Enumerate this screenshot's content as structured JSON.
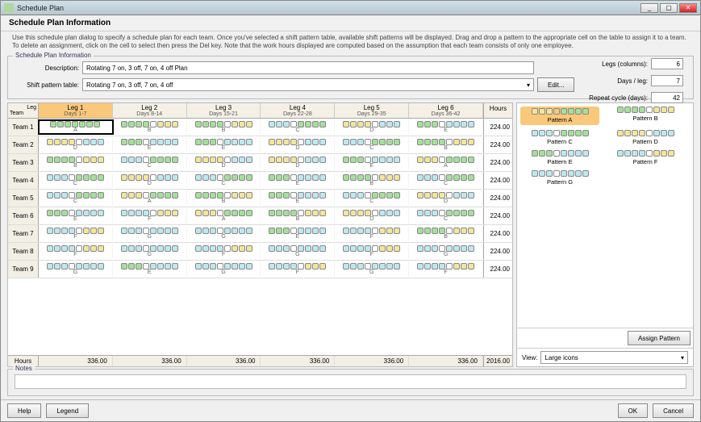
{
  "window_title": "Schedule Plan",
  "header_title": "Schedule Plan Information",
  "instructions": "Use this schedule plan dialog to specify a schedule plan for each team. Once you've selected a shift pattern table, available shift patterns will be displayed. Drag and drop a pattern to the appropriate cell on the table to assign it to a team. To delete an assignment, click on the cell to select then press the Del key. Note that the work hours displayed are computed based on the assumption that each team consists of only one employee.",
  "group_title": "Schedule Plan Information",
  "description_label": "Description:",
  "shift_table_label": "Shift pattern table:",
  "description_value": "Rotating 7 on, 3 off, 7 on, 4 off Plan",
  "shift_table_value": "Rotating 7 on, 3 off, 7 on, 4 off",
  "edit_button": "Edit...",
  "config": {
    "legs_label": "Legs (columns):",
    "legs_value": "6",
    "days_per_leg_label": "Days / leg:",
    "days_per_leg_value": "7",
    "repeat_label": "Repeat cycle (days):",
    "repeat_value": "42"
  },
  "grid": {
    "corner_top": "Leg",
    "corner_left": "Team",
    "hours_header": "Hours",
    "hours_footer_label": "Hours",
    "legs": [
      {
        "title": "Leg 1",
        "sub": "Days 1-7",
        "active": true
      },
      {
        "title": "Leg 2",
        "sub": "Days 8-14",
        "active": false
      },
      {
        "title": "Leg 3",
        "sub": "Days 15-21",
        "active": false
      },
      {
        "title": "Leg 4",
        "sub": "Days 22-28",
        "active": false
      },
      {
        "title": "Leg 5",
        "sub": "Days 29-35",
        "active": false
      },
      {
        "title": "Leg 6",
        "sub": "Days 36-42",
        "active": false
      }
    ],
    "teams": [
      {
        "name": "Team 1",
        "hours": "224.00",
        "cells": [
          {
            "label": "A",
            "pat": "sel"
          },
          {
            "label": "B",
            "pat": "gy"
          },
          {
            "label": "B",
            "pat": "gy"
          },
          {
            "label": "C",
            "pat": "bg"
          },
          {
            "label": "D",
            "pat": "yb"
          },
          {
            "label": "E",
            "pat": "gb"
          }
        ]
      },
      {
        "name": "Team 2",
        "hours": "224.00",
        "cells": [
          {
            "label": "D",
            "pat": "yb"
          },
          {
            "label": "E",
            "pat": "gb"
          },
          {
            "label": "E",
            "pat": "gb"
          },
          {
            "label": "D",
            "pat": "yb"
          },
          {
            "label": "C",
            "pat": "bg"
          },
          {
            "label": "B",
            "pat": "gy"
          }
        ]
      },
      {
        "name": "Team 3",
        "hours": "224.00",
        "cells": [
          {
            "label": "B",
            "pat": "gy"
          },
          {
            "label": "C",
            "pat": "bg"
          },
          {
            "label": "D",
            "pat": "yb"
          },
          {
            "label": "D",
            "pat": "yb"
          },
          {
            "label": "E",
            "pat": "gb"
          },
          {
            "label": "A",
            "pat": "yg"
          }
        ]
      },
      {
        "name": "Team 4",
        "hours": "224.00",
        "cells": [
          {
            "label": "C",
            "pat": "bg"
          },
          {
            "label": "D",
            "pat": "yb"
          },
          {
            "label": "C",
            "pat": "bg"
          },
          {
            "label": "E",
            "pat": "gb"
          },
          {
            "label": "B",
            "pat": "gy"
          },
          {
            "label": "C",
            "pat": "bg"
          }
        ]
      },
      {
        "name": "Team 5",
        "hours": "224.00",
        "cells": [
          {
            "label": "C",
            "pat": "bg"
          },
          {
            "label": "A",
            "pat": "yg"
          },
          {
            "label": "B",
            "pat": "gy"
          },
          {
            "label": "E",
            "pat": "gb"
          },
          {
            "label": "C",
            "pat": "bg"
          },
          {
            "label": "D",
            "pat": "yb"
          }
        ]
      },
      {
        "name": "Team 6",
        "hours": "224.00",
        "cells": [
          {
            "label": "E",
            "pat": "gb"
          },
          {
            "label": "F",
            "pat": "by"
          },
          {
            "label": "A",
            "pat": "yg"
          },
          {
            "label": "B",
            "pat": "gy"
          },
          {
            "label": "D",
            "pat": "yb"
          },
          {
            "label": "C",
            "pat": "bg"
          }
        ]
      },
      {
        "name": "Team 7",
        "hours": "224.00",
        "cells": [
          {
            "label": "F",
            "pat": "by"
          },
          {
            "label": "G",
            "pat": "bb"
          },
          {
            "label": "G",
            "pat": "bb"
          },
          {
            "label": "E",
            "pat": "gb"
          },
          {
            "label": "F",
            "pat": "by"
          },
          {
            "label": "B",
            "pat": "gy"
          }
        ]
      },
      {
        "name": "Team 8",
        "hours": "224.00",
        "cells": [
          {
            "label": "F",
            "pat": "by"
          },
          {
            "label": "G",
            "pat": "bb"
          },
          {
            "label": "F",
            "pat": "by"
          },
          {
            "label": "G",
            "pat": "bb"
          },
          {
            "label": "F",
            "pat": "by"
          },
          {
            "label": "G",
            "pat": "bb"
          }
        ]
      },
      {
        "name": "Team 9",
        "hours": "224.00",
        "cells": [
          {
            "label": "G",
            "pat": "bb"
          },
          {
            "label": "E",
            "pat": "gb"
          },
          {
            "label": "G",
            "pat": "bb"
          },
          {
            "label": "F",
            "pat": "by"
          },
          {
            "label": "G",
            "pat": "bb"
          },
          {
            "label": "F",
            "pat": "by"
          }
        ]
      }
    ],
    "leg_totals": [
      "336.00",
      "336.00",
      "336.00",
      "336.00",
      "336.00",
      "336.00"
    ],
    "grand_total": "2016.00"
  },
  "palette": {
    "patterns": [
      {
        "name": "Pattern A",
        "pat": "yg",
        "active": true
      },
      {
        "name": "Pattern B",
        "pat": "gy",
        "active": false
      },
      {
        "name": "Pattern C",
        "pat": "bg",
        "active": false
      },
      {
        "name": "Pattern D",
        "pat": "yb",
        "active": false
      },
      {
        "name": "Pattern E",
        "pat": "gb",
        "active": false
      },
      {
        "name": "Pattern F",
        "pat": "by",
        "active": false
      },
      {
        "name": "Pattern G",
        "pat": "bb",
        "active": false
      }
    ],
    "assign_button": "Assign Pattern",
    "view_label": "View:",
    "view_value": "Large icons"
  },
  "notes_title": "Notes",
  "buttons": {
    "help": "Help",
    "legend": "Legend",
    "ok": "OK",
    "cancel": "Cancel"
  }
}
